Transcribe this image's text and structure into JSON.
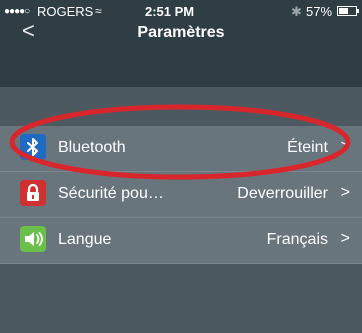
{
  "status_bar": {
    "signal": "●●●●○",
    "carrier": "ROGERS",
    "wifi": "≈",
    "time": "2:51 PM",
    "bluetooth": "✱",
    "battery_text": "57%",
    "battery_level": 0.57
  },
  "nav": {
    "back": "<",
    "title": "Paramètres"
  },
  "settings": [
    {
      "icon": "bluetooth-icon",
      "label": "Bluetooth",
      "value": "Éteint",
      "chevron": ">"
    },
    {
      "icon": "lock-icon",
      "label": "Sécurité pou…",
      "value": "Deverrouiller",
      "chevron": ">"
    },
    {
      "icon": "speaker-icon",
      "label": "Langue",
      "value": "Français",
      "chevron": ">"
    }
  ],
  "colors": {
    "topbar": "#2f3d45",
    "background": "#4d5961",
    "row": "#68757c",
    "highlight": "#d9262c",
    "bluetooth_icon": "#1f6ac3",
    "lock_icon": "#d0302f",
    "speaker_icon": "#6ac04a"
  }
}
